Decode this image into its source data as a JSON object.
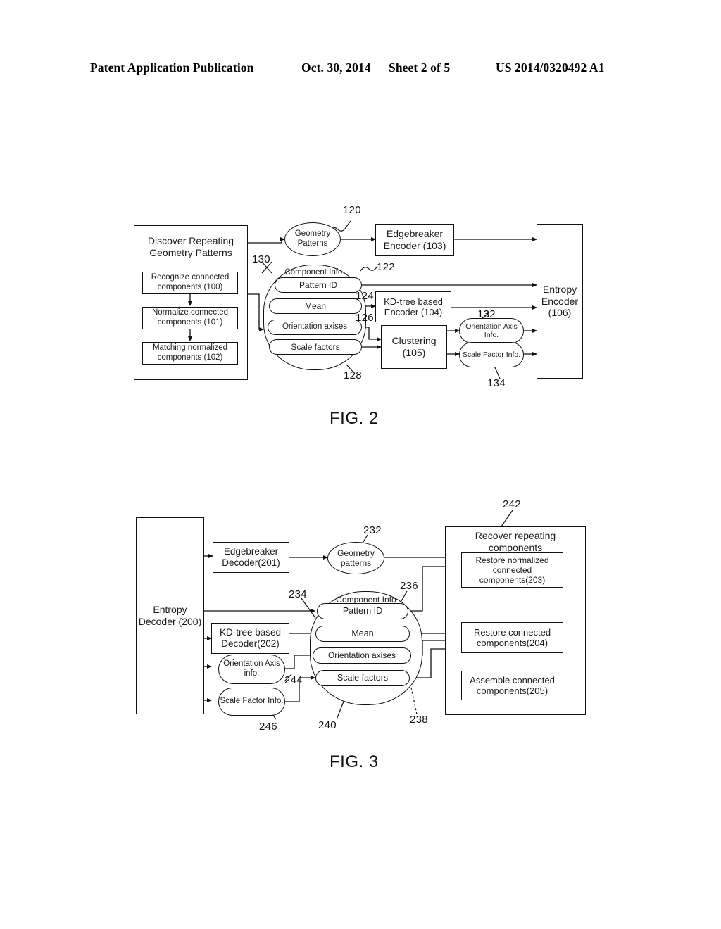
{
  "header": {
    "publication": "Patent Application Publication",
    "date": "Oct. 30, 2014",
    "sheet": "Sheet 2 of 5",
    "pub_number": "US 2014/0320492 A1"
  },
  "figures": [
    {
      "caption": "FIG. 2",
      "id": "fig2",
      "nodes": {
        "discover_title": "Discover Repeating Geometry Patterns",
        "recognize": "Recognize connected components (100)",
        "normalize": "Normalize connected components (101)",
        "matching": "Matching normalized components (102)",
        "geometry_patterns": "Geometry Patterns",
        "edgebreaker_encoder": "Edgebreaker Encoder (103)",
        "component_info": "Component Info.",
        "pattern_id": "Pattern ID",
        "mean": "Mean",
        "orientation_axises": "Orientation axises",
        "scale_factors": "Scale factors",
        "kdtree_encoder": "KD-tree based Encoder (104)",
        "clustering": "Clustering (105)",
        "orientation_axis_info": "Orientation Axis Info.",
        "scale_factor_info": "Scale Factor Info.",
        "entropy_encoder": "Entropy Encoder (106)"
      },
      "refs": [
        "120",
        "122",
        "124",
        "126",
        "128",
        "130",
        "132",
        "134"
      ]
    },
    {
      "caption": "FIG. 3",
      "id": "fig3",
      "nodes": {
        "entropy_decoder": "Entropy Decoder (200)",
        "edgebreaker_decoder": "Edgebreaker Decoder(201)",
        "kdtree_decoder": "KD-tree based Decoder(202)",
        "orientation_axis_info": "Orientation Axis info.",
        "scale_factor_info": "Scale Factor Info.",
        "geometry_patterns": "Geometry patterns",
        "component_info": "Component Info",
        "pattern_id": "Pattern ID",
        "mean": "Mean",
        "orientation_axises": "Orientation axises",
        "scale_factors": "Scale factors",
        "recover_title": "Recover repeating components",
        "restore_normalized": "Restore normalized connected components(203)",
        "restore_connected": "Restore connected components(204)",
        "assemble_connected": "Assemble connected components(205)"
      },
      "refs": [
        "232",
        "234",
        "236",
        "238",
        "240",
        "242",
        "244",
        "246"
      ]
    }
  ],
  "colors": {
    "ink": "#111111",
    "paper": "#ffffff"
  }
}
